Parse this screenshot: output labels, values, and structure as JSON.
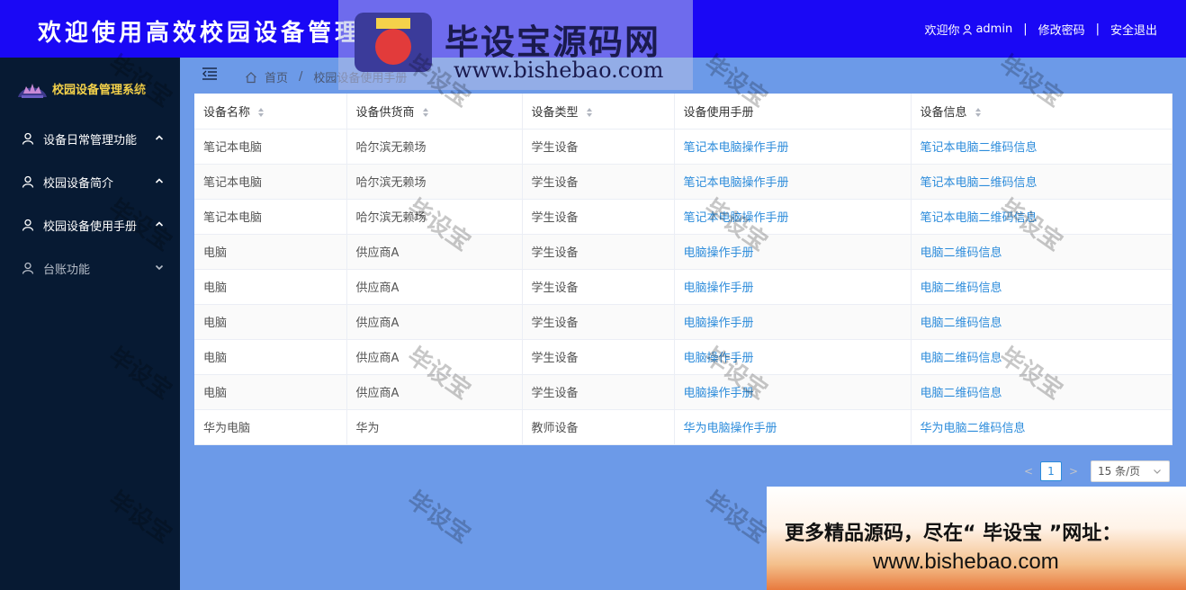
{
  "header": {
    "title": "欢迎使用高效校园设备管理系统",
    "welcome": "欢迎你",
    "username": "admin",
    "change_password": "修改密码",
    "logout": "安全退出",
    "background": "#1a08f5"
  },
  "sidebar": {
    "logo_text": "校园设备管理系统",
    "items": [
      {
        "label": "设备日常管理功能",
        "icon": "user-icon",
        "arrow": "chevron-up-icon"
      },
      {
        "label": "校园设备简介",
        "icon": "user-icon",
        "arrow": "chevron-up-icon"
      },
      {
        "label": "校园设备使用手册",
        "icon": "user-icon",
        "arrow": "chevron-up-icon"
      },
      {
        "label": "台账功能",
        "icon": "user-icon",
        "arrow": "chevron-down-icon"
      }
    ]
  },
  "breadcrumb": {
    "home": "首页",
    "current": "校园设备使用手册"
  },
  "table": {
    "columns": [
      "设备名称",
      "设备供货商",
      "设备类型",
      "设备使用手册",
      "设备信息"
    ],
    "rows": [
      [
        "笔记本电脑",
        "哈尔滨无赖场",
        "学生设备",
        "笔记本电脑操作手册",
        "笔记本电脑二维码信息"
      ],
      [
        "笔记本电脑",
        "哈尔滨无赖场",
        "学生设备",
        "笔记本电脑操作手册",
        "笔记本电脑二维码信息"
      ],
      [
        "笔记本电脑",
        "哈尔滨无赖场",
        "学生设备",
        "笔记本电脑操作手册",
        "笔记本电脑二维码信息"
      ],
      [
        "电脑",
        "供应商A",
        "学生设备",
        "电脑操作手册",
        "电脑二维码信息"
      ],
      [
        "电脑",
        "供应商A",
        "学生设备",
        "电脑操作手册",
        "电脑二维码信息"
      ],
      [
        "电脑",
        "供应商A",
        "学生设备",
        "电脑操作手册",
        "电脑二维码信息"
      ],
      [
        "电脑",
        "供应商A",
        "学生设备",
        "电脑操作手册",
        "电脑二维码信息"
      ],
      [
        "电脑",
        "供应商A",
        "学生设备",
        "电脑操作手册",
        "电脑二维码信息"
      ],
      [
        "华为电脑",
        "华为",
        "教师设备",
        "华为电脑操作手册",
        "华为电脑二维码信息"
      ]
    ]
  },
  "pagination": {
    "current_page": "1",
    "page_size": "15 条/页"
  },
  "watermark": {
    "text": "毕设宝",
    "logo_cn": "毕设宝源码网",
    "logo_url": "www.bishebao.com",
    "ad_line1": "更多精品源码，尽在“ 毕设宝 ”网址：",
    "ad_line2": "www.bishebao.com"
  }
}
